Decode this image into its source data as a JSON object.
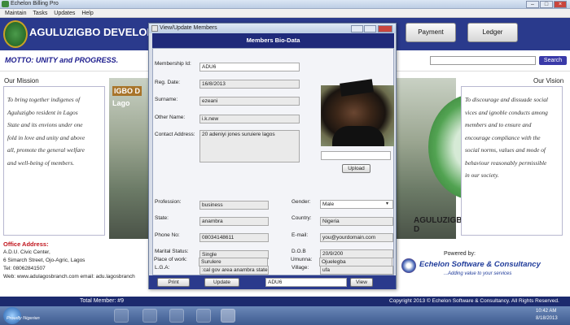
{
  "window": {
    "title": "Echelon Billing Pro",
    "controls": [
      "–",
      "□",
      "×"
    ]
  },
  "menu": [
    "Maintain",
    "Tasks",
    "Updates",
    "Help"
  ],
  "banner": {
    "title": "AGULUZIGBO DEVELOPMEN",
    "payment_label": "Payment",
    "ledger_label": "Ledger"
  },
  "motto": "MOTTO:  UNITY and PROGRESS.",
  "search": {
    "button_label": "Search",
    "value": ""
  },
  "mission": {
    "heading": "Our Mission",
    "lines": [
      "To bring together indigenes of",
      "Aguluzigbo resident in Lagos",
      "State and its envions under one",
      "fold in love and unity and above",
      "all, promote the general welfare",
      "and well-being of members."
    ]
  },
  "vision": {
    "heading": "Our Vision",
    "lines": [
      "To discourage and dissuade social",
      "vices and ignoble conducts among",
      "members and to ensure and",
      "encourage compliance with the",
      "social norms, values and mode of",
      "behaviour reasonably permissible",
      "in our society."
    ]
  },
  "center_image": {
    "sign_text": "IGBO D",
    "sign_text2": "Lago",
    "seal_label": "AGULUZIGBO D"
  },
  "office": {
    "heading": "Office Address:",
    "lines": [
      "A.D.U. Civic Center,",
      "6 Simarch Street, Ojo-Agric, Lagos",
      "Tel: 08062841507",
      "Web: www.adulagosbranch.com   email: adu.lagosbranch"
    ]
  },
  "powered": {
    "label": "Powered by:",
    "company": "Echelon Software & Consultancy",
    "tagline": "...Adding value to your services"
  },
  "footer": {
    "total": "Total Member: #9",
    "copyright": "Copyright 2013 © Echelon Software & Consultancy. All Rights Reserved."
  },
  "taskbar": {
    "brand": "Proudly Nigerian",
    "time": "10:42 AM",
    "date": "8/18/2013"
  },
  "dialog": {
    "title": "View/Update Members",
    "header": "Members Bio-Data",
    "membership_id_label": "Membership Id:",
    "membership_id": "ADU6",
    "reg_date_label": "Reg. Date:",
    "reg_date": "16/8/2013",
    "surname_label": "Surname:",
    "surname": "ezeani",
    "other_name_label": "Other Name:",
    "other_name": "i.k.new",
    "contact_label": "Contact Address:",
    "contact": "20 adeniyi jones suruiere lagos",
    "upload_label": "Upload",
    "profession_label": "Profession:",
    "profession": "business",
    "gender_label": "Gender:",
    "gender": "Male",
    "state_label": "State:",
    "state": "anambra",
    "country_label": "Country:",
    "country": "Nigeria",
    "phone_label": "Phone No:",
    "phone": "08034148611",
    "email_label": "E-mail:",
    "email": "you@yourdomain.com",
    "marital_label": "Marital Status:",
    "marital": "Single",
    "dob_label": "D.O.B",
    "dob": "20/9/200",
    "lga_label": "L.G.A:",
    "lga": ":cal gov area anambra state",
    "village_label": "Village:",
    "village": "ufa",
    "work_label": "Place of work:",
    "work": "Surulere",
    "umunna_label": "Umunna:",
    "umunna": "Ojuelegba",
    "print_label": "Print",
    "update_label": "Update",
    "select_value": "ADU6",
    "view_label": "View"
  }
}
